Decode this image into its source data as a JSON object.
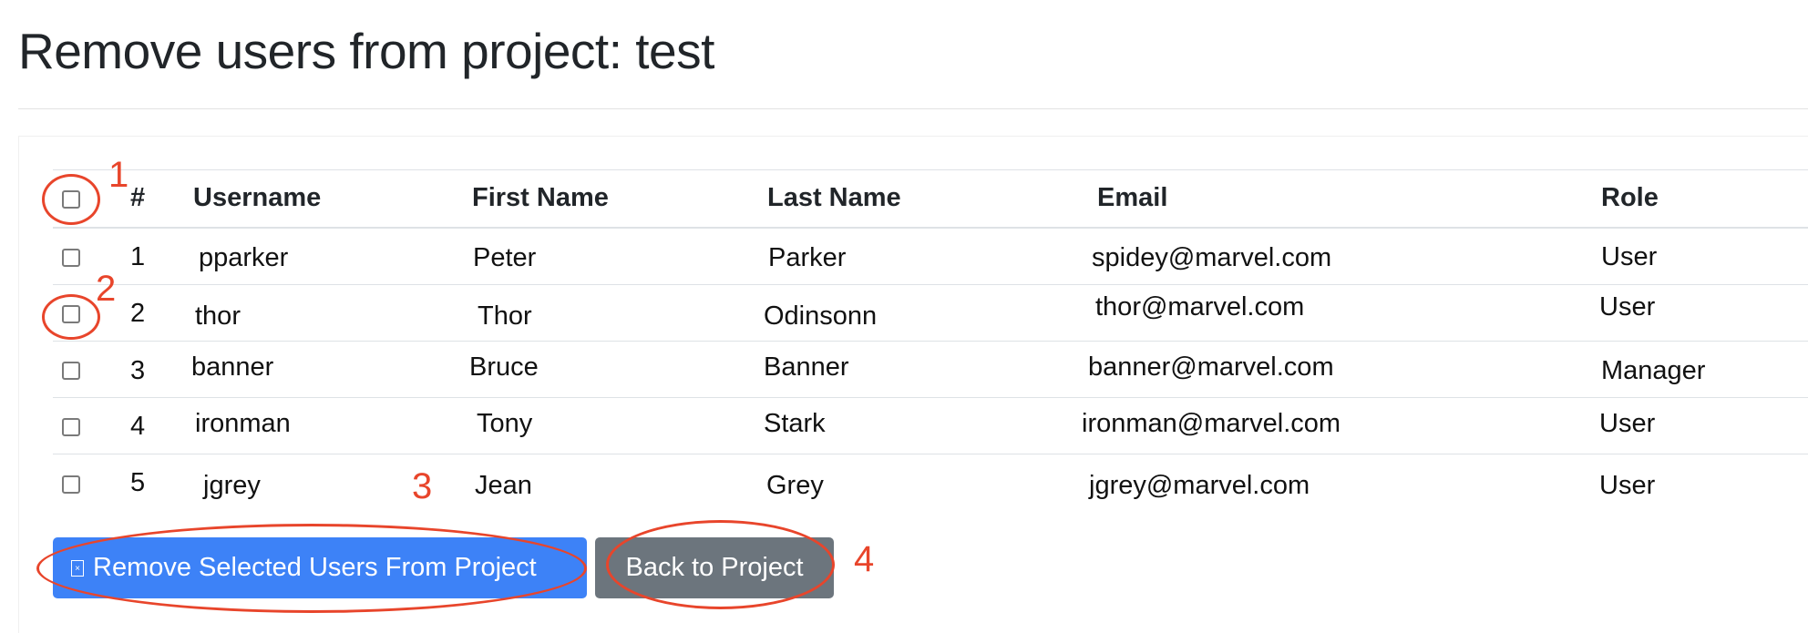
{
  "page": {
    "title": "Remove users from project: test"
  },
  "table": {
    "headers": [
      "#",
      "Username",
      "First Name",
      "Last Name",
      "Email",
      "Role"
    ],
    "rows": [
      {
        "num": "1",
        "username": "pparker",
        "first": "Peter",
        "last": "Parker",
        "email": "spidey@marvel.com",
        "role": "User"
      },
      {
        "num": "2",
        "username": "thor",
        "first": "Thor",
        "last": "Odinsonn",
        "email": "thor@marvel.com",
        "role": "User"
      },
      {
        "num": "3",
        "username": "banner",
        "first": "Bruce",
        "last": "Banner",
        "email": "banner@marvel.com",
        "role": "Manager"
      },
      {
        "num": "4",
        "username": "ironman",
        "first": "Tony",
        "last": "Stark",
        "email": "ironman@marvel.com",
        "role": "User"
      },
      {
        "num": "5",
        "username": "jgrey",
        "first": "Jean",
        "last": "Grey",
        "email": "jgrey@marvel.com",
        "role": "User"
      }
    ]
  },
  "actions": {
    "remove_label": "Remove Selected Users From Project",
    "back_label": "Back to Project"
  },
  "annotations": {
    "one": "1",
    "two": "2",
    "three": "3",
    "four": "4"
  },
  "colors": {
    "primary": "#3d82f7",
    "secondary": "#6c757d",
    "annotation": "#e8452b"
  }
}
